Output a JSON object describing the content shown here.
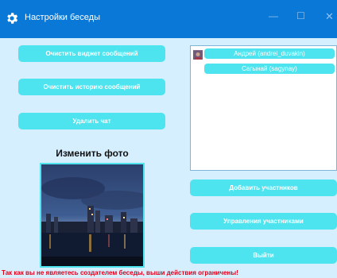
{
  "window": {
    "title": "Настройки беседы",
    "icon": "gear-icon",
    "controls": [
      "minimize",
      "maximize",
      "close"
    ]
  },
  "left": {
    "buttons": [
      "Очистить виджет сообщений",
      "Очистить историю сообщений",
      "Удалить чат"
    ],
    "photo_label": "Изменить фото"
  },
  "right": {
    "members": [
      "Андрей (andrei_duvakin)",
      "Сагынай (sagynay)"
    ],
    "buttons": [
      "Добавить участников",
      "Управления участниками",
      "Выйти"
    ]
  },
  "warning": "Так как вы не являетесь создателем беседы, выши действия ограничены!",
  "colors": {
    "titlebar": "#0a78d7",
    "button": "#4de3ef",
    "background": "#d6efff",
    "warning": "#e0001a"
  }
}
